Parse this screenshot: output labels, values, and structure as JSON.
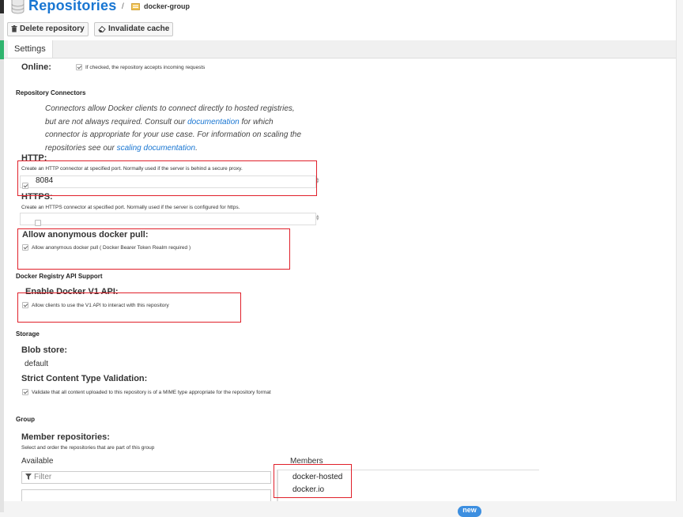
{
  "header": {
    "title": "Repositories",
    "separator": "/",
    "breadcrumb": "docker-group"
  },
  "toolbar": {
    "delete_label": "Delete repository",
    "invalidate_label": "Invalidate cache"
  },
  "tabs": [
    {
      "label": "Settings",
      "active": true
    }
  ],
  "settings": {
    "online": {
      "label": "Online:",
      "checkbox_text": "If checked, the repository accepts incoming requests",
      "checked": true
    },
    "connectors": {
      "heading": "Repository Connectors",
      "desc_1": "Connectors allow Docker clients to connect directly to hosted registries, but are not always required. Consult our ",
      "desc_link_1": "documentation",
      "desc_2": " for which connector is appropriate for your use case. For information on scaling the repositories see our ",
      "desc_link_2": "scaling documentation",
      "desc_3": "."
    },
    "http": {
      "label": "HTTP:",
      "help": "Create an HTTP connector at specified port. Normally used if the server is behind a secure proxy.",
      "checked": true,
      "port": "8084"
    },
    "https": {
      "label": "HTTPS:",
      "help": "Create an HTTPS connector at specified port. Normally used if the server is configured for https.",
      "checked": false,
      "port": ""
    },
    "anon_pull": {
      "label": "Allow anonymous docker pull:",
      "checkbox_text": "Allow anonymous docker pull ( Docker Bearer Token Realm required )",
      "checked": true
    },
    "api_support": {
      "heading": "Docker Registry API Support",
      "label": "Enable Docker V1 API:",
      "checkbox_text": "Allow clients to use the V1 API to interact with this repository",
      "checked": true
    },
    "storage": {
      "heading": "Storage",
      "blob_label": "Blob store:",
      "blob_value": "default",
      "strict_label": "Strict Content Type Validation:",
      "strict_text": "Validate that all content uploaded to this repository is of a MIME type appropriate for the repository format",
      "strict_checked": true
    },
    "group": {
      "heading": "Group",
      "members_label": "Member repositories:",
      "members_help": "Select and order the repositories that are part of this group",
      "available_label": "Available",
      "filter_placeholder": "Filter",
      "members_col_label": "Members",
      "members": [
        "docker-hosted",
        "docker.io"
      ]
    }
  },
  "badge": {
    "new": "new"
  },
  "colors": {
    "accent": "#1976d2",
    "highlight": "#e0202a",
    "active_strip": "#2fb46e"
  }
}
